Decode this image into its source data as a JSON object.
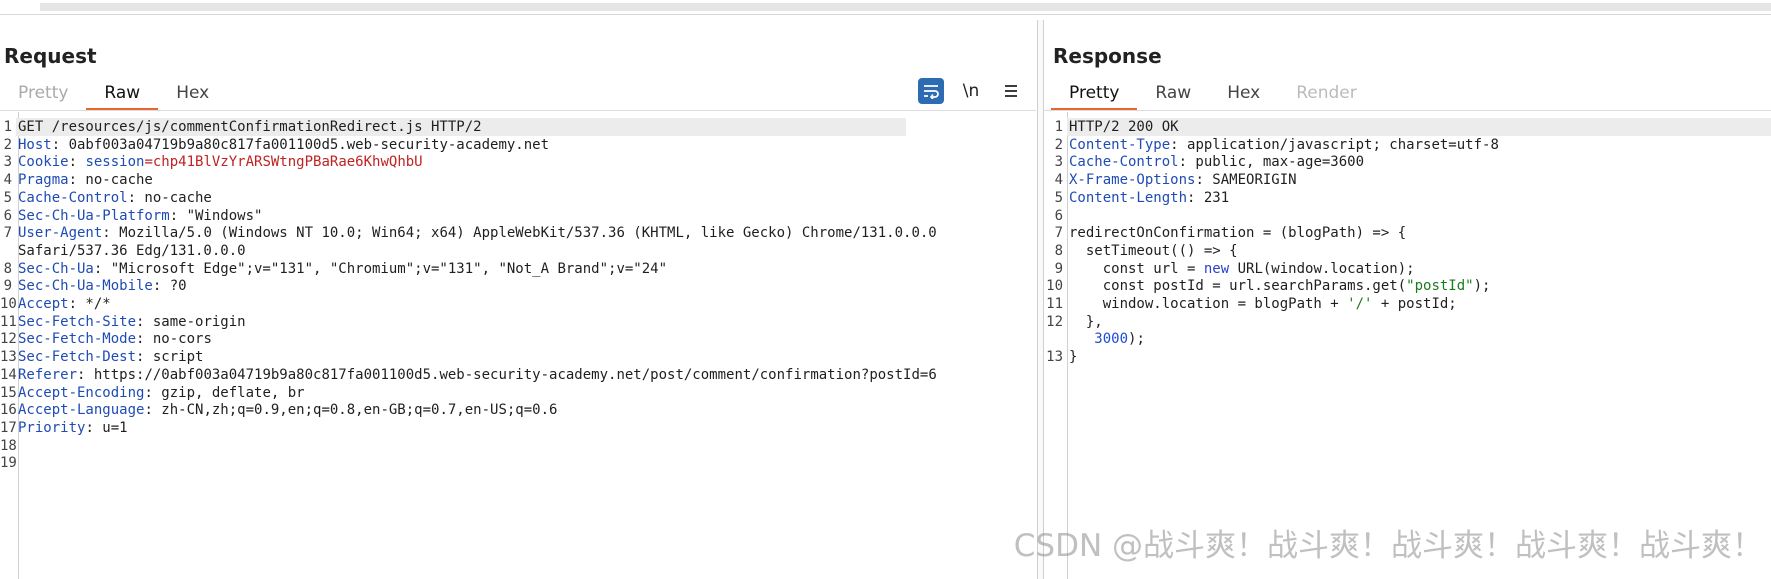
{
  "request": {
    "title": "Request",
    "tabs": [
      {
        "label": "Pretty",
        "state": "muted"
      },
      {
        "label": "Raw",
        "state": "active"
      },
      {
        "label": "Hex",
        "state": "normal"
      }
    ],
    "tools": {
      "wrap_icon": "text-wrap-icon",
      "newline_label": "\\n",
      "menu_icon": "hamburger-menu-icon"
    },
    "lines": [
      {
        "n": "1",
        "parts": [
          {
            "t": "GET /resources/js/commentConfirmationRedirect.js HTTP/2"
          }
        ],
        "highlight": true
      },
      {
        "n": "2",
        "parts": [
          {
            "t": "Host",
            "c": "key"
          },
          {
            "t": ": 0abf003a04719b9a80c817fa001100d5.web-security-academy.net"
          }
        ]
      },
      {
        "n": "3",
        "parts": [
          {
            "t": "Cookie",
            "c": "key"
          },
          {
            "t": ": "
          },
          {
            "t": "session",
            "c": "key"
          },
          {
            "t": "=chp41BlVzYrARSWtngPBaRae6KhwQhbU",
            "c": "cookie"
          }
        ]
      },
      {
        "n": "4",
        "parts": [
          {
            "t": "Pragma",
            "c": "key"
          },
          {
            "t": ": no-cache"
          }
        ]
      },
      {
        "n": "5",
        "parts": [
          {
            "t": "Cache-Control",
            "c": "key"
          },
          {
            "t": ": no-cache"
          }
        ]
      },
      {
        "n": "6",
        "parts": [
          {
            "t": "Sec-Ch-Ua-Platform",
            "c": "key"
          },
          {
            "t": ": \"Windows\""
          }
        ]
      },
      {
        "n": "7",
        "parts": [
          {
            "t": "User-Agent",
            "c": "key"
          },
          {
            "t": ": Mozilla/5.0 (Windows NT 10.0; Win64; x64) AppleWebKit/537.36 (KHTML, like Gecko) Chrome/131.0.0.0"
          }
        ]
      },
      {
        "n": "",
        "parts": [
          {
            "t": "Safari/537.36 Edg/131.0.0.0"
          }
        ]
      },
      {
        "n": "8",
        "parts": [
          {
            "t": "Sec-Ch-Ua",
            "c": "key"
          },
          {
            "t": ": \"Microsoft Edge\";v=\"131\", \"Chromium\";v=\"131\", \"Not_A Brand\";v=\"24\""
          }
        ]
      },
      {
        "n": "9",
        "parts": [
          {
            "t": "Sec-Ch-Ua-Mobile",
            "c": "key"
          },
          {
            "t": ": ?0"
          }
        ]
      },
      {
        "n": "10",
        "parts": [
          {
            "t": "Accept",
            "c": "key"
          },
          {
            "t": ": */*"
          }
        ]
      },
      {
        "n": "11",
        "parts": [
          {
            "t": "Sec-Fetch-Site",
            "c": "key"
          },
          {
            "t": ": same-origin"
          }
        ]
      },
      {
        "n": "12",
        "parts": [
          {
            "t": "Sec-Fetch-Mode",
            "c": "key"
          },
          {
            "t": ": no-cors"
          }
        ]
      },
      {
        "n": "13",
        "parts": [
          {
            "t": "Sec-Fetch-Dest",
            "c": "key"
          },
          {
            "t": ": script"
          }
        ]
      },
      {
        "n": "14",
        "parts": [
          {
            "t": "Referer",
            "c": "key"
          },
          {
            "t": ": https://0abf003a04719b9a80c817fa001100d5.web-security-academy.net/post/comment/confirmation?postId=6"
          }
        ]
      },
      {
        "n": "15",
        "parts": [
          {
            "t": "Accept-Encoding",
            "c": "key"
          },
          {
            "t": ": gzip, deflate, br"
          }
        ]
      },
      {
        "n": "16",
        "parts": [
          {
            "t": "Accept-Language",
            "c": "key"
          },
          {
            "t": ": zh-CN,zh;q=0.9,en;q=0.8,en-GB;q=0.7,en-US;q=0.6"
          }
        ]
      },
      {
        "n": "17",
        "parts": [
          {
            "t": "Priority",
            "c": "key"
          },
          {
            "t": ": u=1"
          }
        ]
      },
      {
        "n": "18",
        "parts": [
          {
            "t": ""
          }
        ]
      },
      {
        "n": "19",
        "parts": [
          {
            "t": ""
          }
        ]
      }
    ]
  },
  "response": {
    "title": "Response",
    "tabs": [
      {
        "label": "Pretty",
        "state": "active"
      },
      {
        "label": "Raw",
        "state": "normal"
      },
      {
        "label": "Hex",
        "state": "normal"
      },
      {
        "label": "Render",
        "state": "disabled"
      }
    ],
    "lines": [
      {
        "n": "1",
        "parts": [
          {
            "t": "HTTP/2 200 OK"
          }
        ],
        "highlight": true
      },
      {
        "n": "2",
        "parts": [
          {
            "t": "Content-Type",
            "c": "key"
          },
          {
            "t": ": application/javascript; charset=utf-8"
          }
        ]
      },
      {
        "n": "3",
        "parts": [
          {
            "t": "Cache-Control",
            "c": "key"
          },
          {
            "t": ": public, max-age=3600"
          }
        ]
      },
      {
        "n": "4",
        "parts": [
          {
            "t": "X-Frame-Options",
            "c": "key"
          },
          {
            "t": ": SAMEORIGIN"
          }
        ]
      },
      {
        "n": "5",
        "parts": [
          {
            "t": "Content-Length",
            "c": "key"
          },
          {
            "t": ": 231"
          }
        ]
      },
      {
        "n": "6",
        "parts": [
          {
            "t": ""
          }
        ]
      },
      {
        "n": "7",
        "parts": [
          {
            "t": "redirectOnConfirmation = (blogPath) => {"
          }
        ]
      },
      {
        "n": "8",
        "parts": [
          {
            "t": "  setTimeout(() => {"
          }
        ]
      },
      {
        "n": "9",
        "parts": [
          {
            "t": "    const url = "
          },
          {
            "t": "new",
            "c": "kw"
          },
          {
            "t": " URL(window.location);"
          }
        ]
      },
      {
        "n": "10",
        "parts": [
          {
            "t": "    const postId = url.searchParams.get("
          },
          {
            "t": "\"postId\"",
            "c": "str"
          },
          {
            "t": ");"
          }
        ]
      },
      {
        "n": "11",
        "parts": [
          {
            "t": "    window.location = blogPath + "
          },
          {
            "t": "'/'",
            "c": "str"
          },
          {
            "t": " + postId;"
          }
        ]
      },
      {
        "n": "12",
        "parts": [
          {
            "t": "  },"
          }
        ]
      },
      {
        "n": "",
        "parts": [
          {
            "t": "   "
          },
          {
            "t": "3000",
            "c": "num"
          },
          {
            "t": ");"
          }
        ]
      },
      {
        "n": "13",
        "parts": [
          {
            "t": "}"
          }
        ]
      }
    ]
  },
  "watermark": "CSDN @战斗爽！战斗爽！战斗爽！战斗爽！战斗爽！"
}
